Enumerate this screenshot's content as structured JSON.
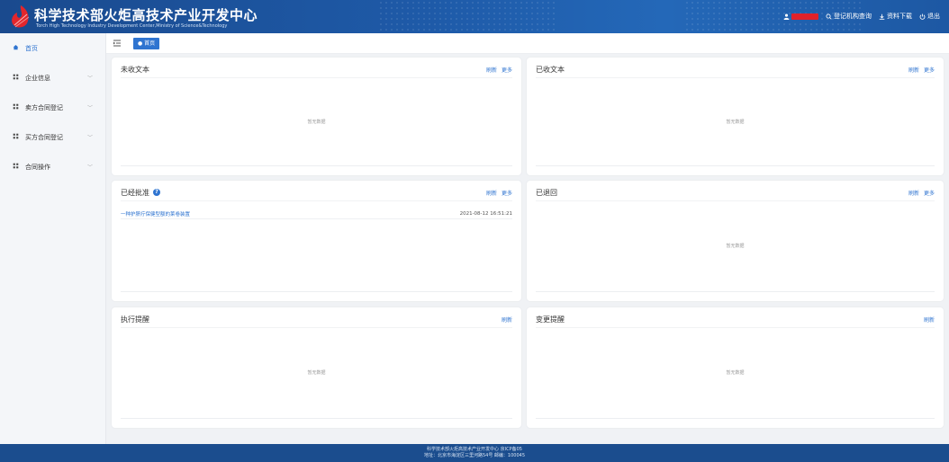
{
  "header": {
    "title_zh": "科学技术部火炬高技术产业开发中心",
    "title_en": "Torch High Technology Industry Development Center,Ministry of Science&Technology",
    "org_search": "登记机构查询",
    "download": "资料下载",
    "logout": "退出",
    "user_color": "#e0222a"
  },
  "sidebar": {
    "items": [
      {
        "label": "首页",
        "icon": "home-icon"
      },
      {
        "label": "企业信息",
        "icon": "grid-icon"
      },
      {
        "label": "卖方合同登记",
        "icon": "grid-icon"
      },
      {
        "label": "买方合同登记",
        "icon": "grid-icon"
      },
      {
        "label": "合同操作",
        "icon": "grid-icon"
      }
    ]
  },
  "tabs": {
    "home": "首页"
  },
  "panels": {
    "unreceived": {
      "title": "未收文本",
      "refresh": "刷新",
      "more": "更多",
      "empty": "暂无数据"
    },
    "received": {
      "title": "已收文本",
      "refresh": "刷新",
      "more": "更多",
      "empty": "暂无数据"
    },
    "approved": {
      "title": "已经批准",
      "refresh": "刷新",
      "more": "更多",
      "rows": [
        {
          "title": "一种护脐疗保健型额的莱卷装置",
          "date": "2021-08-12 16:51:21"
        }
      ]
    },
    "returned": {
      "title": "已退回",
      "refresh": "刷新",
      "more": "更多",
      "empty": "暂无数据"
    },
    "exec_reminder": {
      "title": "执行提醒",
      "refresh": "刷新",
      "empty": "暂无数据"
    },
    "change_reminder": {
      "title": "变更提醒",
      "refresh": "刷新",
      "empty": "暂无数据"
    }
  },
  "footer": {
    "line1": "科学技术部火炬高技术产业开发中心 京ICP备05",
    "line2": "地址：北京市海淀区三里河路54号 邮编：100045"
  },
  "colors": {
    "accent": "#2f74d0",
    "header": "#1e5aa8",
    "footer": "#1b4d8e"
  }
}
